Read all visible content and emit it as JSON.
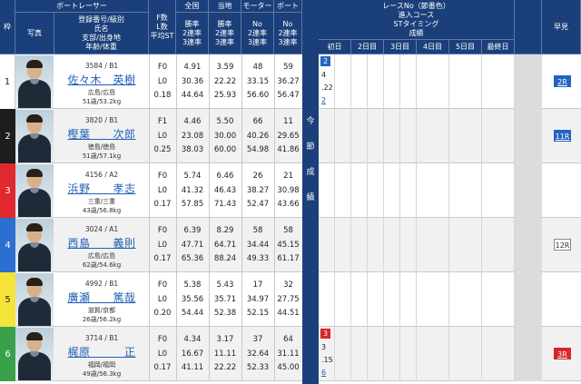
{
  "header": {
    "waku": "枠",
    "photo": "写真",
    "racer_group": "ボートレーサー",
    "racer_fields": [
      "登録番号/級別",
      "氏名",
      "支部/出身地",
      "年齢/体重"
    ],
    "fl_st": [
      "F数",
      "L数",
      "平均ST"
    ],
    "national": {
      "title": "全国",
      "rows": [
        "勝率",
        "2連率",
        "3連率"
      ]
    },
    "local": {
      "title": "当地",
      "rows": [
        "勝率",
        "2連率",
        "3連率"
      ]
    },
    "motor": {
      "title": "モーター",
      "rows": [
        "No",
        "2連率",
        "3連率"
      ]
    },
    "boat": {
      "title": "ボート",
      "rows": [
        "No",
        "2連率",
        "3連率"
      ]
    },
    "session_sub": "今節成績",
    "race_info": [
      "レースNo（節番色）",
      "進入コース",
      "STタイミング",
      "成績"
    ],
    "days": [
      "初日",
      "2日目",
      "3日目",
      "4日目",
      "5日目",
      "最終日"
    ],
    "early": "早見"
  },
  "racers": [
    {
      "waku": "1",
      "color": "#ffffff",
      "text_color": "#222222",
      "reg": "3584 / B1",
      "name": "佐々木　英樹",
      "branch": "広島/広島",
      "age_weight": "51歳/53.2kg",
      "f": "F0",
      "l": "L0",
      "st": "0.18",
      "nat": [
        "4.91",
        "30.36",
        "44.64"
      ],
      "loc": [
        "3.59",
        "22.22",
        "25.93"
      ],
      "motor": [
        "48",
        "33.15",
        "56.60"
      ],
      "boat": [
        "59",
        "36.27",
        "56.47"
      ],
      "day1": {
        "race": "2",
        "race_color": "#2364c2",
        "course": "4",
        "st": ".22",
        "result": "2"
      },
      "early": "2R",
      "early_color": "#2364c2"
    },
    {
      "waku": "2",
      "color": "#1d1d1d",
      "text_color": "#ffffff",
      "reg": "3820 / B1",
      "name": "樫葉　　次郎",
      "branch": "徳島/徳島",
      "age_weight": "51歳/57.1kg",
      "f": "F1",
      "l": "L0",
      "st": "0.25",
      "nat": [
        "4.46",
        "23.08",
        "38.03"
      ],
      "loc": [
        "5.50",
        "30.00",
        "60.00"
      ],
      "motor": [
        "66",
        "40.26",
        "54.98"
      ],
      "boat": [
        "11",
        "29.65",
        "41.86"
      ],
      "day1": null,
      "early": "11R",
      "early_color": "#2364c2"
    },
    {
      "waku": "3",
      "color": "#e0292e",
      "text_color": "#ffffff",
      "reg": "4156 / A2",
      "name": "浜野　　孝志",
      "branch": "三重/三重",
      "age_weight": "43歳/56.8kg",
      "f": "F0",
      "l": "L0",
      "st": "0.17",
      "nat": [
        "5.74",
        "41.32",
        "57.85"
      ],
      "loc": [
        "6.46",
        "46.43",
        "71.43"
      ],
      "motor": [
        "26",
        "38.27",
        "52.47"
      ],
      "boat": [
        "21",
        "30.98",
        "43.66"
      ],
      "day1": null,
      "early": "",
      "early_color": ""
    },
    {
      "waku": "4",
      "color": "#2b6fd0",
      "text_color": "#ffffff",
      "reg": "3024 / A1",
      "name": "西島　　義則",
      "branch": "広島/広島",
      "age_weight": "62歳/54.6kg",
      "f": "F0",
      "l": "L0",
      "st": "0.17",
      "nat": [
        "6.39",
        "47.71",
        "65.36"
      ],
      "loc": [
        "8.29",
        "64.71",
        "88.24"
      ],
      "motor": [
        "58",
        "34.44",
        "49.33"
      ],
      "boat": [
        "58",
        "45.15",
        "61.17"
      ],
      "day1": null,
      "early": "12R",
      "early_color": "#ffffff"
    },
    {
      "waku": "5",
      "color": "#f5e33a",
      "text_color": "#222222",
      "reg": "4992 / B1",
      "name": "廣瀬　　篤哉",
      "branch": "滋賀/京都",
      "age_weight": "26歳/56.2kg",
      "f": "F0",
      "l": "L0",
      "st": "0.20",
      "nat": [
        "5.38",
        "35.56",
        "54.44"
      ],
      "loc": [
        "5.43",
        "35.71",
        "52.38"
      ],
      "motor": [
        "17",
        "34.97",
        "52.15"
      ],
      "boat": [
        "32",
        "27.75",
        "44.51"
      ],
      "day1": null,
      "early": "",
      "early_color": ""
    },
    {
      "waku": "6",
      "color": "#3aa14b",
      "text_color": "#ffffff",
      "reg": "3714 / B1",
      "name": "梶原　　　正",
      "branch": "福岡/福岡",
      "age_weight": "49歳/56.3kg",
      "f": "F0",
      "l": "L0",
      "st": "0.17",
      "nat": [
        "4.34",
        "16.67",
        "41.11"
      ],
      "loc": [
        "3.17",
        "11.11",
        "22.22"
      ],
      "motor": [
        "37",
        "32.64",
        "52.33"
      ],
      "boat": [
        "64",
        "31.11",
        "45.00"
      ],
      "day1": {
        "race": "3",
        "race_color": "#d8262b",
        "course": "3",
        "st": ".15",
        "result": "6"
      },
      "early": "3R",
      "early_color": "#d8262b"
    }
  ]
}
